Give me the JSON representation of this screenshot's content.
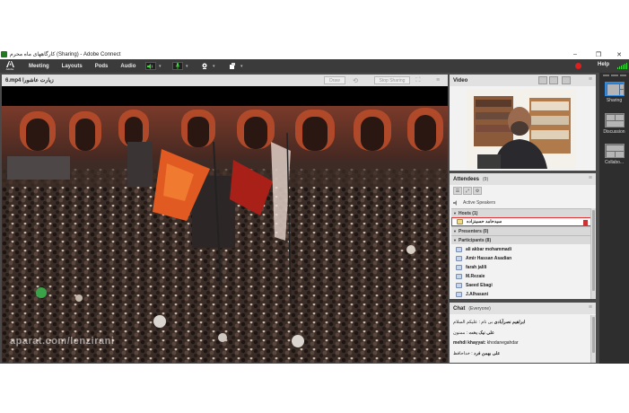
{
  "window": {
    "title": "کارگاههای ماه محرم (Sharing) - Adobe Connect",
    "controls": [
      "–",
      "❐",
      "✕"
    ]
  },
  "menubar": {
    "logo_text": "Adobe",
    "items": [
      "Meeting",
      "Layouts",
      "Pods",
      "Audio"
    ],
    "help_label": "Help",
    "tools": [
      {
        "icon": "speaker-icon",
        "color": "#3ddb3d"
      },
      {
        "icon": "microphone-icon",
        "color": "#3ddb3d"
      },
      {
        "icon": "webcam-icon",
        "color": "#ffffff"
      },
      {
        "icon": "raise-hand-icon",
        "color": "#ffffff"
      }
    ]
  },
  "share_pod": {
    "title": "6.mp4 زیارت عاشورا",
    "buttons": {
      "draw": "Draw",
      "stop_sharing": "Stop Sharing"
    },
    "watermark": "aparat.com/lenzirani"
  },
  "video_pod": {
    "title": "Video"
  },
  "attendees_pod": {
    "title": "Attendees",
    "count": "(9)",
    "active_speakers": "Active Speakers",
    "groups": [
      {
        "label": "Hosts (1)",
        "members": [
          "سیدحامد حسینزاده"
        ]
      },
      {
        "label": "Presenters (0)",
        "members": []
      },
      {
        "label": "Participants (8)",
        "members": [
          "ali akbar mohammadi",
          "Amir Hassan Asadian",
          "farah jalili",
          "M.Rezaie",
          "Saeed Ebagi",
          "J.Alhasani"
        ]
      }
    ]
  },
  "chat_pod": {
    "title": "Chat",
    "scope": "(Everyone)",
    "messages": [
      {
        "sender": "ابراهیم نصرآبادی",
        "text": "بی نام : علیکم السلام"
      },
      {
        "sender": "علی نیک بخت",
        "text": ": ممنون"
      },
      {
        "sender": "mehdi khayyat:",
        "text": "khodanegahdar"
      },
      {
        "sender": "علی بهمن فرد",
        "text": ": خداحافظ"
      }
    ]
  },
  "layouts_bar": {
    "items": [
      "Sharing",
      "Discussion",
      "Collabo..."
    ],
    "active": "Sharing"
  },
  "colors": {
    "accent": "#2e8ae0",
    "record": "#e01e1e",
    "signal": "#3ddb3d"
  }
}
